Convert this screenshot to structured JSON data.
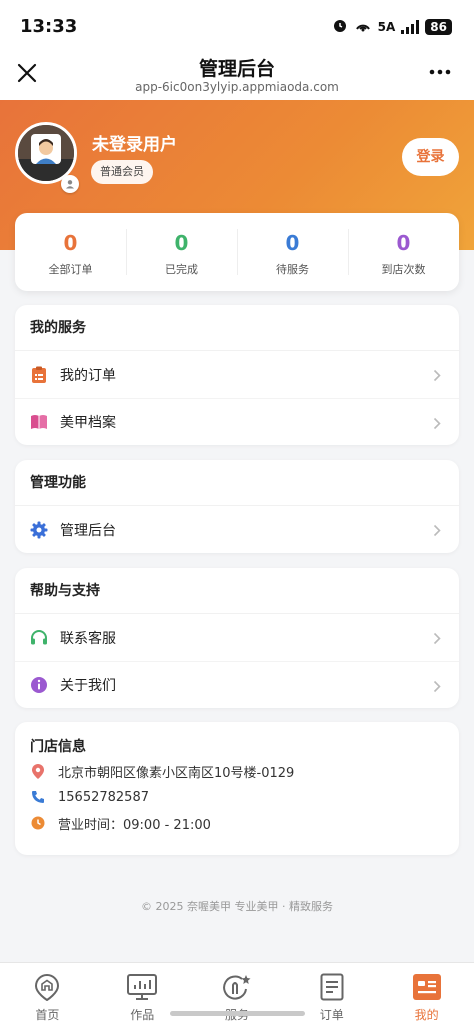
{
  "status_bar": {
    "time": "13:33",
    "network": "5A",
    "battery": "86"
  },
  "header": {
    "title": "管理后台",
    "subtitle": "app-6ic0on3ylyip.appmiaoda.com"
  },
  "profile": {
    "username": "未登录用户",
    "member_level": "普通会员",
    "login_label": "登录"
  },
  "stats": [
    {
      "value": "0",
      "label": "全部订单",
      "color": "#e8733a"
    },
    {
      "value": "0",
      "label": "已完成",
      "color": "#3fb36b"
    },
    {
      "value": "0",
      "label": "待服务",
      "color": "#3a7bd5"
    },
    {
      "value": "0",
      "label": "到店次数",
      "color": "#9b59d0"
    }
  ],
  "services": {
    "title": "我的服务",
    "items": [
      {
        "label": "我的订单",
        "icon": "clipboard-icon"
      },
      {
        "label": "美甲档案",
        "icon": "book-icon"
      }
    ]
  },
  "management": {
    "title": "管理功能",
    "items": [
      {
        "label": "管理后台",
        "icon": "gear-icon"
      }
    ]
  },
  "help": {
    "title": "帮助与支持",
    "items": [
      {
        "label": "联系客服",
        "icon": "headset-icon"
      },
      {
        "label": "关于我们",
        "icon": "info-icon"
      }
    ]
  },
  "store": {
    "title": "门店信息",
    "address": "北京市朝阳区像素小区南区10号楼-0129",
    "phone": "15652782587",
    "hours": "营业时间：09:00 - 21:00"
  },
  "footer": "© 2025 奈喔美甲 专业美甲 · 精致服务",
  "tabs": [
    {
      "label": "首页",
      "icon": "home-icon",
      "active": false
    },
    {
      "label": "作品",
      "icon": "monitor-icon",
      "active": false
    },
    {
      "label": "服务",
      "icon": "sparkle-icon",
      "active": false
    },
    {
      "label": "订单",
      "icon": "document-icon",
      "active": false
    },
    {
      "label": "我的",
      "icon": "profile-card-icon",
      "active": true
    }
  ],
  "colors": {
    "accent": "#e8733a",
    "gradient_end": "#f0a43a"
  }
}
